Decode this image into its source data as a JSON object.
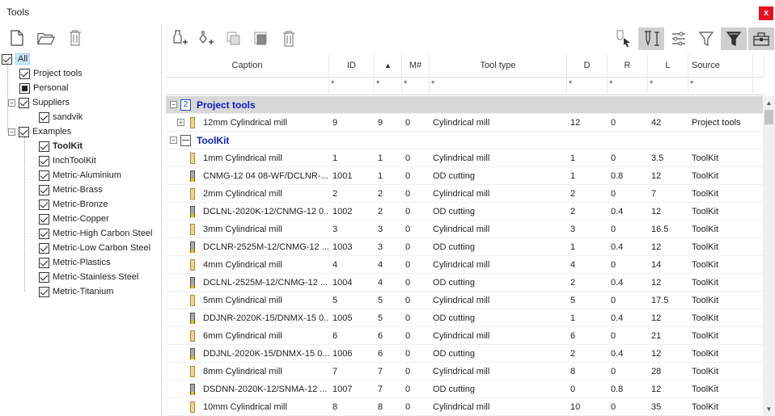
{
  "window": {
    "title": "Tools",
    "close_label": "x"
  },
  "tree": {
    "root": {
      "label": "All"
    },
    "items": [
      {
        "label": "Project tools",
        "state": "checked",
        "level": 1,
        "bold": false
      },
      {
        "label": "Personal",
        "state": "partial",
        "level": 1,
        "bold": false
      },
      {
        "label": "Suppliers",
        "state": "checked",
        "level": 1,
        "bold": false
      },
      {
        "label": "sandvik",
        "state": "checked",
        "level": 2,
        "bold": false
      },
      {
        "label": "Examples",
        "state": "checked",
        "level": 1,
        "bold": false
      },
      {
        "label": "ToolKit",
        "state": "checked",
        "level": 2,
        "bold": true
      },
      {
        "label": "InchToolKit",
        "state": "checked",
        "level": 2,
        "bold": false
      },
      {
        "label": "Metric-Aluminium",
        "state": "checked",
        "level": 2,
        "bold": false
      },
      {
        "label": "Metric-Brass",
        "state": "checked",
        "level": 2,
        "bold": false
      },
      {
        "label": "Metric-Bronze",
        "state": "checked",
        "level": 2,
        "bold": false
      },
      {
        "label": "Metric-Copper",
        "state": "checked",
        "level": 2,
        "bold": false
      },
      {
        "label": "Metric-High Carbon Steel",
        "state": "checked",
        "level": 2,
        "bold": false
      },
      {
        "label": "Metric-Low Carbon Steel",
        "state": "checked",
        "level": 2,
        "bold": false
      },
      {
        "label": "Metric-Plastics",
        "state": "checked",
        "level": 2,
        "bold": false
      },
      {
        "label": "Metric-Stainless Steel",
        "state": "checked",
        "level": 2,
        "bold": false
      },
      {
        "label": "Metric-Titanium",
        "state": "checked",
        "level": 2,
        "bold": false
      }
    ]
  },
  "left_toolbar": {
    "icons": [
      "new-file-icon",
      "open-folder-icon",
      "delete-trash-icon"
    ]
  },
  "right_toolbar": {
    "icons": [
      "new-tool-icon",
      "new-tool-holder-icon",
      "copy-icon",
      "paste-icon",
      "delete-trash-icon"
    ],
    "right_icons": [
      "pick-tool-icon",
      "tool-dimensions-icon",
      "columns-settings-icon",
      "filter-icon",
      "filter-active-icon",
      "toolbox-icon"
    ]
  },
  "grid": {
    "columns": [
      {
        "key": "caption",
        "label": "Caption"
      },
      {
        "key": "id",
        "label": "ID"
      },
      {
        "key": "sort",
        "label": "▲"
      },
      {
        "key": "m",
        "label": "M#"
      },
      {
        "key": "type",
        "label": "Tool type"
      },
      {
        "key": "d",
        "label": "D"
      },
      {
        "key": "r",
        "label": "R"
      },
      {
        "key": "l",
        "label": "L"
      },
      {
        "key": "source",
        "label": "Source"
      }
    ],
    "filter_placeholder": "*",
    "groups": [
      {
        "title": "Project tools",
        "badge": "2"
      },
      {
        "title": "ToolKit"
      }
    ],
    "rows": [
      {
        "group": 0,
        "kind": "mill",
        "caption": "12mm Cylindrical mill",
        "id": "9",
        "sort": "9",
        "m": "0",
        "type": "Cylindrical mill",
        "d": "12",
        "r": "0",
        "l": "42",
        "source": "Project tools"
      },
      {
        "group": 1,
        "kind": "mill",
        "caption": "1mm Cylindrical mill",
        "id": "1",
        "sort": "1",
        "m": "0",
        "type": "Cylindrical mill",
        "d": "1",
        "r": "0",
        "l": "3.5",
        "source": "ToolKit"
      },
      {
        "group": 1,
        "kind": "od",
        "caption": "CNMG-12 04 08-WF/DCLNR-...",
        "id": "1001",
        "sort": "1",
        "m": "0",
        "type": "OD cutting",
        "d": "1",
        "r": "0.8",
        "l": "12",
        "source": "ToolKit"
      },
      {
        "group": 1,
        "kind": "mill",
        "caption": "2mm Cylindrical mill",
        "id": "2",
        "sort": "2",
        "m": "0",
        "type": "Cylindrical mill",
        "d": "2",
        "r": "0",
        "l": "7",
        "source": "ToolKit"
      },
      {
        "group": 1,
        "kind": "od",
        "caption": "DCLNL-2020K-12/CNMG-12 0...",
        "id": "1002",
        "sort": "2",
        "m": "0",
        "type": "OD cutting",
        "d": "2",
        "r": "0.4",
        "l": "12",
        "source": "ToolKit"
      },
      {
        "group": 1,
        "kind": "mill",
        "caption": "3mm Cylindrical mill",
        "id": "3",
        "sort": "3",
        "m": "0",
        "type": "Cylindrical mill",
        "d": "3",
        "r": "0",
        "l": "16.5",
        "source": "ToolKit"
      },
      {
        "group": 1,
        "kind": "od",
        "caption": "DCLNR-2525M-12/CNMG-12 ...",
        "id": "1003",
        "sort": "3",
        "m": "0",
        "type": "OD cutting",
        "d": "1",
        "r": "0.4",
        "l": "12",
        "source": "ToolKit"
      },
      {
        "group": 1,
        "kind": "mill",
        "caption": "4mm Cylindrical mill",
        "id": "4",
        "sort": "4",
        "m": "0",
        "type": "Cylindrical mill",
        "d": "4",
        "r": "0",
        "l": "14",
        "source": "ToolKit"
      },
      {
        "group": 1,
        "kind": "od",
        "caption": "DCLNL-2525M-12/CNMG-12 ...",
        "id": "1004",
        "sort": "4",
        "m": "0",
        "type": "OD cutting",
        "d": "2",
        "r": "0.4",
        "l": "12",
        "source": "ToolKit"
      },
      {
        "group": 1,
        "kind": "mill",
        "caption": "5mm Cylindrical mill",
        "id": "5",
        "sort": "5",
        "m": "0",
        "type": "Cylindrical mill",
        "d": "5",
        "r": "0",
        "l": "17.5",
        "source": "ToolKit"
      },
      {
        "group": 1,
        "kind": "od",
        "caption": "DDJNR-2020K-15/DNMX-15 0...",
        "id": "1005",
        "sort": "5",
        "m": "0",
        "type": "OD cutting",
        "d": "1",
        "r": "0.4",
        "l": "12",
        "source": "ToolKit"
      },
      {
        "group": 1,
        "kind": "mill",
        "caption": "6mm Cylindrical mill",
        "id": "6",
        "sort": "6",
        "m": "0",
        "type": "Cylindrical mill",
        "d": "6",
        "r": "0",
        "l": "21",
        "source": "ToolKit"
      },
      {
        "group": 1,
        "kind": "od",
        "caption": "DDJNL-2020K-15/DNMX-15 0...",
        "id": "1006",
        "sort": "6",
        "m": "0",
        "type": "OD cutting",
        "d": "2",
        "r": "0.4",
        "l": "12",
        "source": "ToolKit"
      },
      {
        "group": 1,
        "kind": "mill",
        "caption": "8mm Cylindrical mill",
        "id": "7",
        "sort": "7",
        "m": "0",
        "type": "Cylindrical mill",
        "d": "8",
        "r": "0",
        "l": "28",
        "source": "ToolKit"
      },
      {
        "group": 1,
        "kind": "od",
        "caption": "DSDNN-2020K-12/SNMA-12 ...",
        "id": "1007",
        "sort": "7",
        "m": "0",
        "type": "OD cutting",
        "d": "0",
        "r": "0.8",
        "l": "12",
        "source": "ToolKit"
      },
      {
        "group": 1,
        "kind": "mill",
        "caption": "10mm Cylindrical mill",
        "id": "8",
        "sort": "8",
        "m": "0",
        "type": "Cylindrical mill",
        "d": "10",
        "r": "0",
        "l": "35",
        "source": "ToolKit"
      }
    ]
  },
  "colors": {
    "group_title": "#1020c0",
    "selection": "#cde8ff",
    "close": "#e81123"
  }
}
